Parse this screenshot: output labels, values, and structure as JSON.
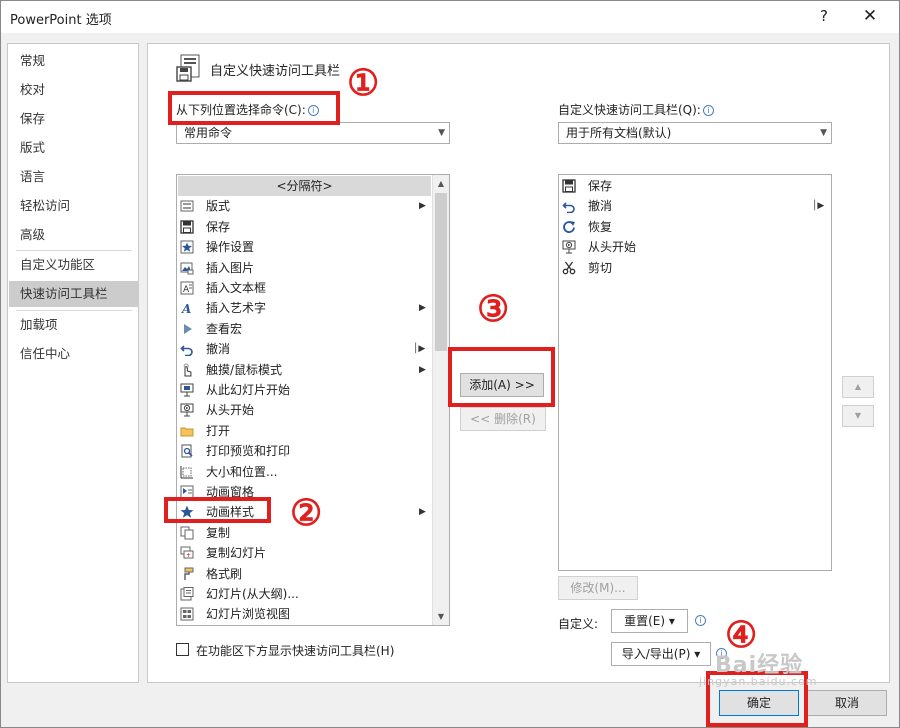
{
  "window": {
    "title": "PowerPoint 选项",
    "help": "?",
    "close": "✕"
  },
  "nav": {
    "items": [
      {
        "label": "常规"
      },
      {
        "label": "校对"
      },
      {
        "label": "保存"
      },
      {
        "label": "版式"
      },
      {
        "label": "语言"
      },
      {
        "label": "轻松访问"
      },
      {
        "label": "高级"
      },
      {
        "label": "自定义功能区"
      },
      {
        "label": "快速访问工具栏",
        "selected": true
      },
      {
        "label": "加载项"
      },
      {
        "label": "信任中心"
      }
    ]
  },
  "main": {
    "heading": "自定义快速访问工具栏",
    "choose_label": "从下列位置选择命令(C):",
    "choose_value": "常用命令",
    "customize_label": "自定义快速访问工具栏(Q):",
    "customize_value": "用于所有文档(默认)",
    "commands": [
      {
        "label": "<分隔符>",
        "icon": "separator",
        "separator": true
      },
      {
        "label": "版式",
        "icon": "layout-icon",
        "submenu": true
      },
      {
        "label": "保存",
        "icon": "save-icon"
      },
      {
        "label": "操作设置",
        "icon": "action-star-icon"
      },
      {
        "label": "插入图片",
        "icon": "insert-picture-icon"
      },
      {
        "label": "插入文本框",
        "icon": "text-box-icon"
      },
      {
        "label": "插入艺术字",
        "icon": "wordart-icon",
        "submenu": true
      },
      {
        "label": "查看宏",
        "icon": "play-macro-icon"
      },
      {
        "label": "撤消",
        "icon": "undo-icon",
        "splitter": true
      },
      {
        "label": "触摸/鼠标模式",
        "icon": "touch-mode-icon",
        "submenu": true
      },
      {
        "label": "从此幻灯片开始",
        "icon": "present-current-icon"
      },
      {
        "label": "从头开始",
        "icon": "present-beginning-icon"
      },
      {
        "label": "打开",
        "icon": "folder-icon"
      },
      {
        "label": "打印预览和打印",
        "icon": "print-preview-icon"
      },
      {
        "label": "大小和位置...",
        "icon": "size-position-icon"
      },
      {
        "label": "动画窗格",
        "icon": "animation-pane-icon"
      },
      {
        "label": "动画样式",
        "icon": "animation-star-icon",
        "submenu": true
      },
      {
        "label": "复制",
        "icon": "copy-icon"
      },
      {
        "label": "复制幻灯片",
        "icon": "duplicate-slide-icon"
      },
      {
        "label": "格式刷",
        "icon": "format-painter-icon"
      },
      {
        "label": "幻灯片(从大纲)...",
        "icon": "slide-outline-icon"
      },
      {
        "label": "幻灯片浏览视图",
        "icon": "slide-sorter-icon"
      }
    ],
    "toolbar_items": [
      {
        "label": "保存",
        "icon": "save-icon"
      },
      {
        "label": "撤消",
        "icon": "undo-icon",
        "splitter": true
      },
      {
        "label": "恢复",
        "icon": "redo-icon"
      },
      {
        "label": "从头开始",
        "icon": "present-beginning-icon"
      },
      {
        "label": "剪切",
        "icon": "scissors-icon"
      }
    ],
    "add_button": "添加(A) >>",
    "remove_button": "<< 删除(R)",
    "modify_button": "修改(M)...",
    "customize_text": "自定义:",
    "reset_button": "重置(E) ▾",
    "import_export_button": "导入/导出(P) ▾",
    "show_below_label": "在功能区下方显示快速访问工具栏(H)"
  },
  "footer": {
    "ok": "确定",
    "cancel": "取消"
  },
  "annotations": {
    "callout1": "①",
    "callout2": "②",
    "callout3": "③",
    "callout4": "④",
    "watermark": "Bai经验",
    "watermark_url": "jingyan.baidu.com",
    "highlight_color": "#e0201e"
  }
}
